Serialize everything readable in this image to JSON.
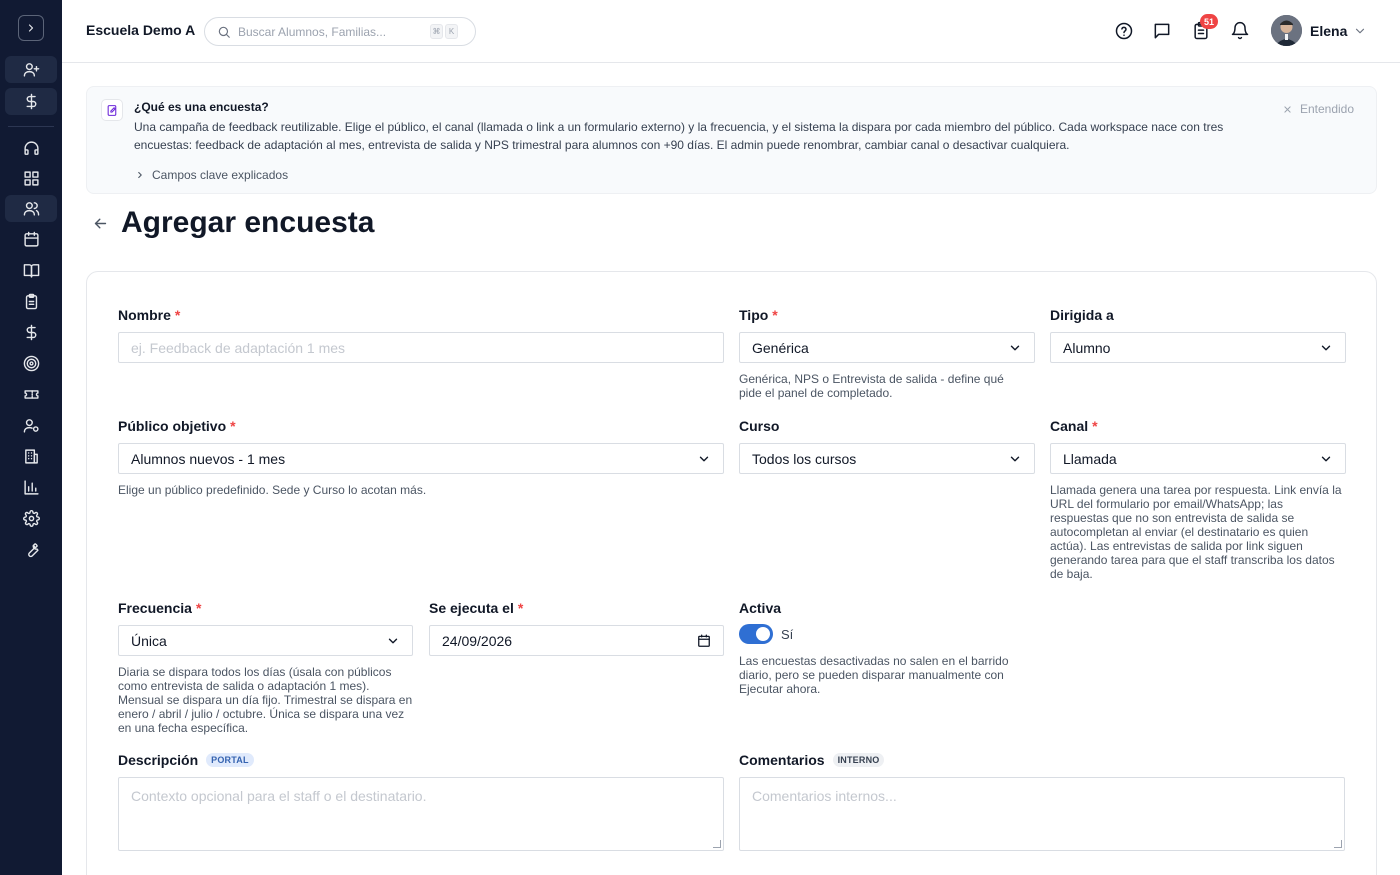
{
  "header": {
    "school": "Escuela Demo A",
    "search_placeholder": "Buscar Alumnos, Familias...",
    "search_kbd": [
      "⌘",
      "K"
    ],
    "tasks_badge": "51",
    "user_name": "Elena"
  },
  "banner": {
    "title": "¿Qué es una encuesta?",
    "text": "Una campaña de feedback reutilizable. Elige el público, el canal (llamada o link a un formulario externo) y la frecuencia, y el sistema la dispara por cada miembro del público. Cada workspace nace con tres encuestas: feedback de adaptación al mes, entrevista de salida y NPS trimestral para alumnos con +90 días. El admin puede renombrar, cambiar canal o desactivar cualquiera.",
    "link": "Campos clave explicados",
    "dismiss": "Entendido"
  },
  "page": {
    "title": "Agregar encuesta"
  },
  "form": {
    "nombre": {
      "label": "Nombre",
      "req": "*",
      "placeholder": "ej. Feedback de adaptación 1 mes"
    },
    "tipo": {
      "label": "Tipo",
      "req": "*",
      "value": "Genérica",
      "help": "Genérica, NPS o Entrevista de salida - define qué pide el panel de completado."
    },
    "dirigida": {
      "label": "Dirigida a",
      "value": "Alumno"
    },
    "publico": {
      "label": "Público objetivo",
      "req": "*",
      "value": "Alumnos nuevos - 1 mes",
      "help": "Elige un público predefinido. Sede y Curso lo acotan más."
    },
    "curso": {
      "label": "Curso",
      "value": "Todos los cursos"
    },
    "canal": {
      "label": "Canal",
      "req": "*",
      "value": "Llamada",
      "help": "Llamada genera una tarea por respuesta. Link envía la URL del formulario por email/WhatsApp; las respuestas que no son entrevista de salida se autocompletan al enviar (el destinatario es quien actúa). Las entrevistas de salida por link siguen generando tarea para que el staff transcriba los datos de baja."
    },
    "frecuencia": {
      "label": "Frecuencia",
      "req": "*",
      "value": "Única",
      "help": "Diaria se dispara todos los días (úsala con públicos como entrevista de salida o adaptación 1 mes). Mensual se dispara un día fijo. Trimestral se dispara en enero / abril / julio / octubre. Única se dispara una vez en una fecha específica."
    },
    "fecha": {
      "label": "Se ejecuta el",
      "req": "*",
      "value": "24/09/2026"
    },
    "activa": {
      "label": "Activa",
      "value": "Sí",
      "on": true,
      "help": "Las encuestas desactivadas no salen en el barrido diario, pero se pueden disparar manualmente con Ejecutar ahora."
    },
    "descripcion": {
      "label": "Descripción",
      "chip": "PORTAL",
      "placeholder": "Contexto opcional para el staff o el destinatario."
    },
    "comentarios": {
      "label": "Comentarios",
      "chip": "INTERNO",
      "placeholder": "Comentarios internos..."
    }
  },
  "colors": {
    "sidebar": "#111a33",
    "accent": "#2f6fd3",
    "required": "#ef4444",
    "badge": "#ef4444"
  },
  "icons": {
    "sidebar": [
      "user-plus-icon",
      "dollar-icon",
      "headset-icon",
      "grid-icon",
      "users-icon",
      "calendar-icon",
      "book-icon",
      "clipboard-icon",
      "dollar-icon",
      "target-icon",
      "ticket-icon",
      "user-cog-icon",
      "building-icon",
      "bar-chart-icon",
      "gear-icon",
      "wrench-icon"
    ],
    "header": [
      "help-icon",
      "message-icon",
      "tasks-icon",
      "bell-icon"
    ]
  }
}
